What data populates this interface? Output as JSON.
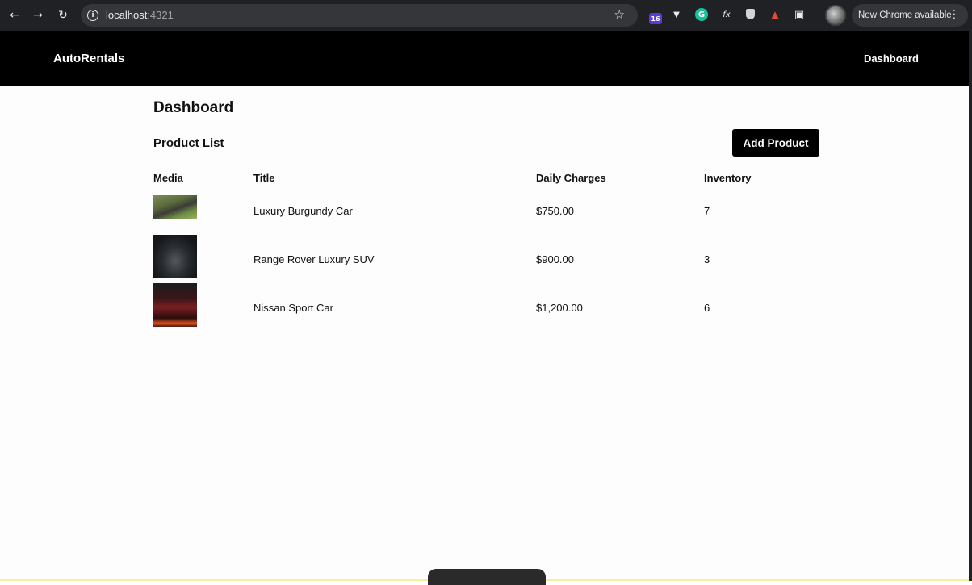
{
  "browser": {
    "url_host": "localhost",
    "url_port": ":4321",
    "extension_badge": "16",
    "extension_fx": "fx",
    "extension_g": "G",
    "update_text": "New Chrome available"
  },
  "header": {
    "brand": "AutoRentals",
    "nav_link": "Dashboard"
  },
  "main": {
    "title": "Dashboard",
    "section_title": "Product List",
    "add_button": "Add Product"
  },
  "table": {
    "headers": [
      "Media",
      "Title",
      "Daily Charges",
      "Inventory"
    ],
    "rows": [
      {
        "title": "Luxury Burgundy Car",
        "daily_charge": "$750.00",
        "inventory": "7"
      },
      {
        "title": "Range Rover Luxury SUV",
        "daily_charge": "$900.00",
        "inventory": "3"
      },
      {
        "title": "Nissan Sport Car",
        "daily_charge": "$1,200.00",
        "inventory": "6"
      }
    ]
  },
  "icons": {
    "back": "back-arrow-icon",
    "forward": "forward-arrow-icon",
    "reload": "reload-icon",
    "info": "info-icon",
    "star": "bookmark-star-icon",
    "extensions": "puzzle-icon",
    "menu": "kebab-menu-icon"
  }
}
